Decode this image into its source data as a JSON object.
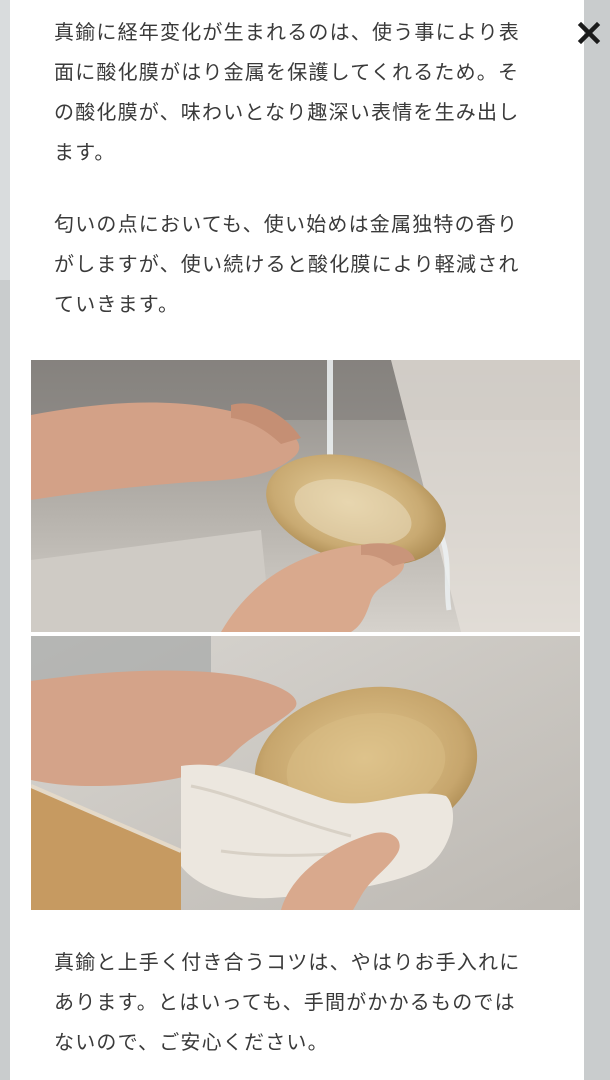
{
  "article": {
    "paragraph_1": {
      "lines": [
        "真鍮に経年変化が生まれるのは、使う事により表",
        "面に酸化膜がはり金属を保護してくれるため。そ",
        "の酸化膜が、味わいとなり趣深い表情を生み出し",
        "ます。"
      ]
    },
    "paragraph_2": {
      "lines": [
        "匂いの点においても、使い始めは金属独特の香り",
        "がしますが、使い続けると酸化膜により軽減され",
        "ていきます。"
      ]
    },
    "paragraph_3": {
      "lines": [
        "真鍮と上手く付き合うコツは、やはりお手入れに",
        "あります。とはいっても、手間がかかるものでは",
        "ないので、ご安心ください。"
      ]
    }
  },
  "icons": {
    "close": "close-icon"
  },
  "colors": {
    "text": "#3a3a3a",
    "panel_background": "#ffffff",
    "page_background": "#c9cccd",
    "brass": "#c9aa72",
    "skin": "#d9a98d",
    "cloth": "#ece7df"
  }
}
